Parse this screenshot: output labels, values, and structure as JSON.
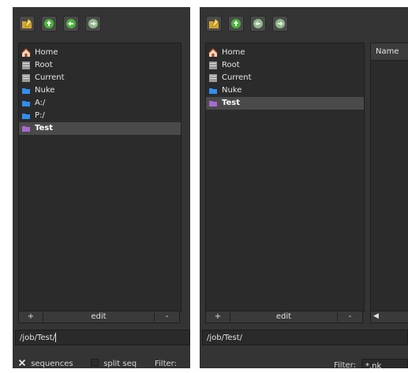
{
  "left": {
    "toolbar": {
      "icons": [
        "new-folder-icon",
        "up-arrow-icon",
        "back-arrow-icon",
        "forward-arrow-icon"
      ]
    },
    "tree": [
      {
        "label": "Home",
        "icon": "home-icon",
        "selected": false
      },
      {
        "label": "Root",
        "icon": "drive-icon",
        "selected": false
      },
      {
        "label": "Current",
        "icon": "drive-icon",
        "selected": false
      },
      {
        "label": "Nuke",
        "icon": "folder-icon",
        "selected": false
      },
      {
        "label": "A:/",
        "icon": "folder-icon",
        "selected": false
      },
      {
        "label": "P:/",
        "icon": "folder-icon",
        "selected": false
      },
      {
        "label": "Test",
        "icon": "folder-purple-icon",
        "selected": true
      }
    ],
    "bottom": {
      "add": "+",
      "edit": "edit",
      "remove": "-"
    },
    "path": "/job/Test/",
    "options": {
      "sequences_label": "sequences",
      "sequences_checked": true,
      "split_seq_label": "split seq",
      "split_seq_checked": false,
      "filter_label": "Filter:"
    }
  },
  "right": {
    "toolbar": {
      "icons": [
        "new-folder-icon",
        "up-arrow-icon",
        "back-arrow-icon",
        "forward-arrow-icon"
      ]
    },
    "tree": [
      {
        "label": "Home",
        "icon": "home-icon",
        "selected": false
      },
      {
        "label": "Root",
        "icon": "drive-icon",
        "selected": false
      },
      {
        "label": "Current",
        "icon": "drive-icon",
        "selected": false
      },
      {
        "label": "Nuke",
        "icon": "folder-icon",
        "selected": false
      },
      {
        "label": "Test",
        "icon": "folder-purple-icon",
        "selected": true
      }
    ],
    "bottom": {
      "add": "+",
      "edit": "edit",
      "remove": "-"
    },
    "files_header": "Name",
    "hscroll_arrow": "◀",
    "path": "/job/Test/",
    "filter_label": "Filter:",
    "filter_value": "*.nk"
  },
  "colors": {
    "panel_bg": "#343434",
    "list_bg": "#2b2b2b",
    "selection": "#4a4a4a",
    "folder_blue": "#2f8ff0",
    "folder_purple": "#a86ad0",
    "arrow_green": "#49b53a"
  }
}
